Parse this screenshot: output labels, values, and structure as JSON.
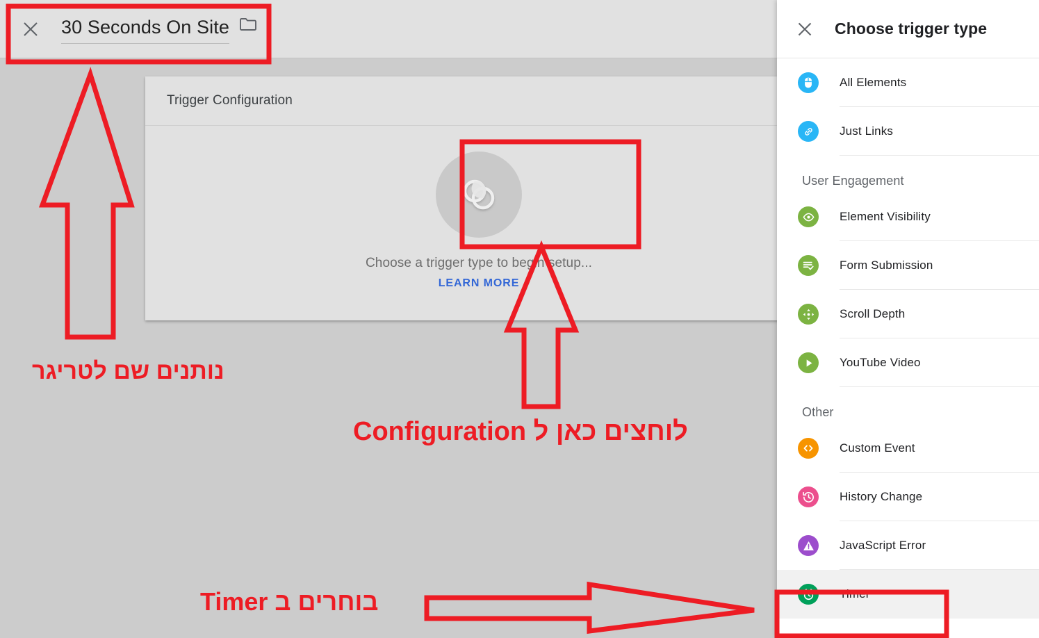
{
  "topbar": {
    "close_icon": "close-icon",
    "trigger_name": "30 Seconds On Site",
    "folder_icon": "folder-icon"
  },
  "config_card": {
    "header_title": "Trigger Configuration",
    "placeholder_icon": "overlapping-circles-icon",
    "placeholder_text": "Choose a trigger type to begin setup...",
    "learn_more_label": "LEARN MORE"
  },
  "right_panel": {
    "close_icon": "close-icon",
    "title": "Choose trigger type",
    "groups": [
      {
        "heading": null,
        "items": [
          {
            "label": "All Elements",
            "icon": "mouse-icon",
            "color": "#29b6f6",
            "highlight": false
          },
          {
            "label": "Just Links",
            "icon": "link-icon",
            "color": "#29b6f6",
            "highlight": false
          }
        ]
      },
      {
        "heading": "User Engagement",
        "items": [
          {
            "label": "Element Visibility",
            "icon": "eye-icon",
            "color": "#7cb342",
            "highlight": false
          },
          {
            "label": "Form Submission",
            "icon": "form-check-icon",
            "color": "#7cb342",
            "highlight": false
          },
          {
            "label": "Scroll Depth",
            "icon": "move-arrows-icon",
            "color": "#7cb342",
            "highlight": false
          },
          {
            "label": "YouTube Video",
            "icon": "play-icon",
            "color": "#7cb342",
            "highlight": false
          }
        ]
      },
      {
        "heading": "Other",
        "items": [
          {
            "label": "Custom Event",
            "icon": "code-brackets-icon",
            "color": "#f79400",
            "highlight": false
          },
          {
            "label": "History Change",
            "icon": "history-clock-icon",
            "color": "#ec4f8d",
            "highlight": false
          },
          {
            "label": "JavaScript Error",
            "icon": "warning-triangle-icon",
            "color": "#9c4dcc",
            "highlight": false
          },
          {
            "label": "Timer",
            "icon": "alarm-clock-icon",
            "color": "#00a05a",
            "highlight": true
          }
        ]
      }
    ]
  },
  "annotations": {
    "accent_color": "#ed1c24",
    "note_name_trigger": "נותנים שם לטריגר",
    "note_click_configuration": "לוחצים כאן ל Configuration",
    "note_choose_timer": "בוחרים ב Timer",
    "boxes": [
      {
        "name": "trigger-name-box"
      },
      {
        "name": "placeholder-icon-box"
      },
      {
        "name": "timer-row-box"
      }
    ],
    "arrows": [
      {
        "name": "arrow-up-to-trigger-name"
      },
      {
        "name": "arrow-up-to-configuration"
      },
      {
        "name": "arrow-right-to-timer"
      }
    ]
  }
}
